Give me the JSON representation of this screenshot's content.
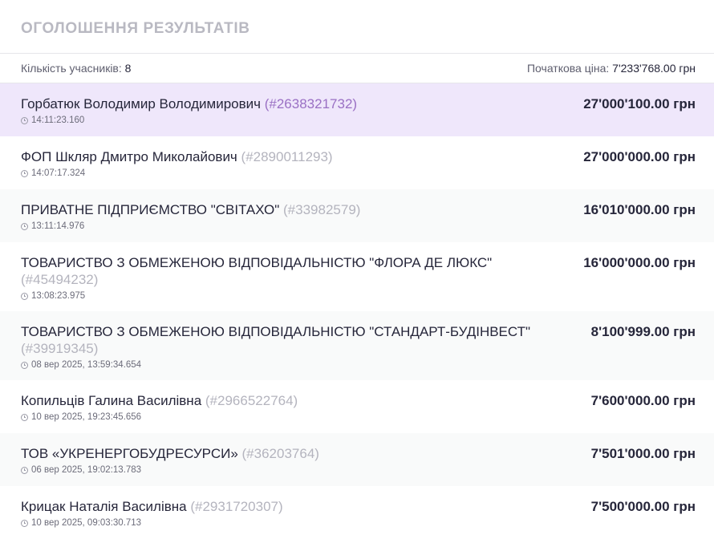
{
  "header": {
    "title": "ОГОЛОШЕННЯ РЕЗУЛЬТАТІВ"
  },
  "summary": {
    "participants_label": "Кількість учасників:",
    "participants_value": "8",
    "start_price_label": "Початкова ціна:",
    "start_price_value": "7'233'768.00 грн"
  },
  "bids": [
    {
      "name": "Горбатюк Володимир Володимирович",
      "id": "(#2638321732)",
      "time": "14:11:23.160",
      "price": "27'000'100.00 грн"
    },
    {
      "name": "ФОП Шкляр Дмитро Миколайович",
      "id": "(#2890011293)",
      "time": "14:07:17.324",
      "price": "27'000'000.00 грн"
    },
    {
      "name": "ПРИВАТНЕ ПІДПРИЄМСТВО \"СВІТАХО\"",
      "id": "(#33982579)",
      "time": "13:11:14.976",
      "price": "16'010'000.00 грн"
    },
    {
      "name": "ТОВАРИСТВО З ОБМЕЖЕНОЮ ВІДПОВІДАЛЬНІСТЮ \"ФЛОРА ДЕ ЛЮКС\"",
      "id": "(#45494232)",
      "time": "13:08:23.975",
      "price": "16'000'000.00 грн"
    },
    {
      "name": "ТОВАРИСТВО З ОБМЕЖЕНОЮ ВІДПОВІДАЛЬНІСТЮ \"СТАНДАРТ-БУДІНВЕСТ\"",
      "id": "(#39919345)",
      "time": "08 вер 2025, 13:59:34.654",
      "price": "8'100'999.00 грн"
    },
    {
      "name": "Копильців Галина Василівна",
      "id": "(#2966522764)",
      "time": "10 вер 2025, 19:23:45.656",
      "price": "7'600'000.00 грн"
    },
    {
      "name": "ТОВ «УКРЕНЕРГОБУДРЕСУРСИ»",
      "id": "(#36203764)",
      "time": "06 вер 2025, 19:02:13.783",
      "price": "7'501'000.00 грн"
    },
    {
      "name": "Крицак Наталія Василівна",
      "id": "(#2931720307)",
      "time": "10 вер 2025, 09:03:30.713",
      "price": "7'500'000.00 грн"
    }
  ]
}
